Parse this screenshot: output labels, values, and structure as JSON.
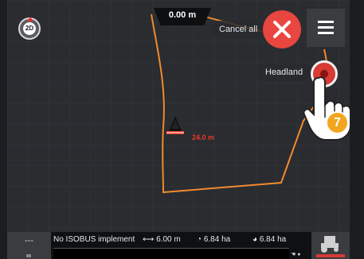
{
  "map": {
    "distance_readout": "0.00 m",
    "view_mode_label": "2D",
    "vehicle_distance_label": "24.0 m",
    "colors": {
      "boundary": "#f08a2e",
      "vehicle_label": "#e83a2a",
      "background": "#2a2c30"
    }
  },
  "actions": {
    "cancel_all_label": "Cancel all",
    "headland_label": "Headland"
  },
  "callout": {
    "step_number": "7",
    "color": "#f2a51e"
  },
  "statusbar": {
    "left_slot_label": "---",
    "implement_label": "No ISOBUS implement",
    "working_width": "6.00 m",
    "area_1": "6.84 ha",
    "area_2": "6.84 ha"
  },
  "icons": {
    "menu": "hamburger-icon",
    "cancel": "close-icon",
    "headland": "record-icon",
    "view_mode": "compass-2d-icon",
    "hand": "pointing-hand-icon",
    "width": "width-arrows-icon",
    "area": "area-icon",
    "tractor": "tractor-icon"
  }
}
